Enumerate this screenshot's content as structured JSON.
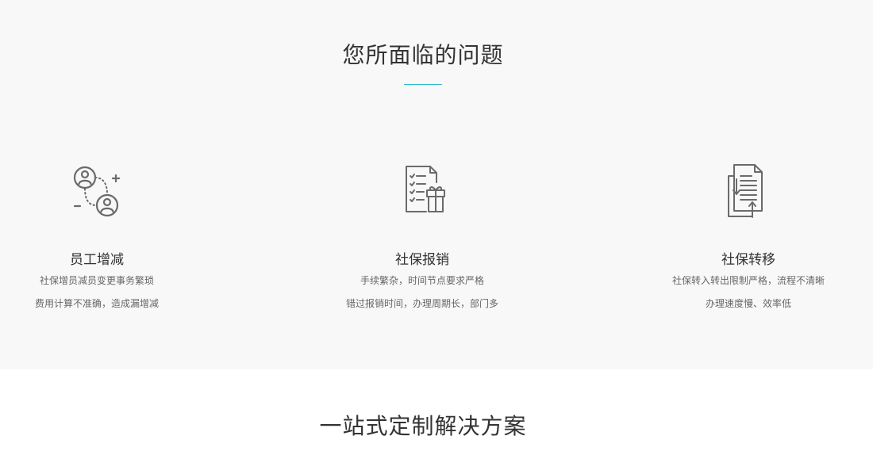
{
  "problems": {
    "title": "您所面临的问题",
    "items": [
      {
        "icon": "user-add-remove-icon",
        "title": "员工增减",
        "lines": [
          "社保增员减员变更事务繁琐",
          "费用计算不准确，造成漏增减"
        ]
      },
      {
        "icon": "checklist-gift-icon",
        "title": "社保报销",
        "lines": [
          "手续繁杂，时间节点要求严格",
          "错过报销时间，办理周期长，部门多"
        ]
      },
      {
        "icon": "document-transfer-icon",
        "title": "社保转移",
        "lines": [
          "社保转入转出限制严格，流程不清晰",
          "办理速度慢、效率低"
        ]
      }
    ]
  },
  "solution": {
    "title": "一站式定制解决方案"
  },
  "colors": {
    "accent": "#2ab7c9",
    "section_bg": "#f8f8f9",
    "icon_stroke": "#6b6b6b"
  }
}
